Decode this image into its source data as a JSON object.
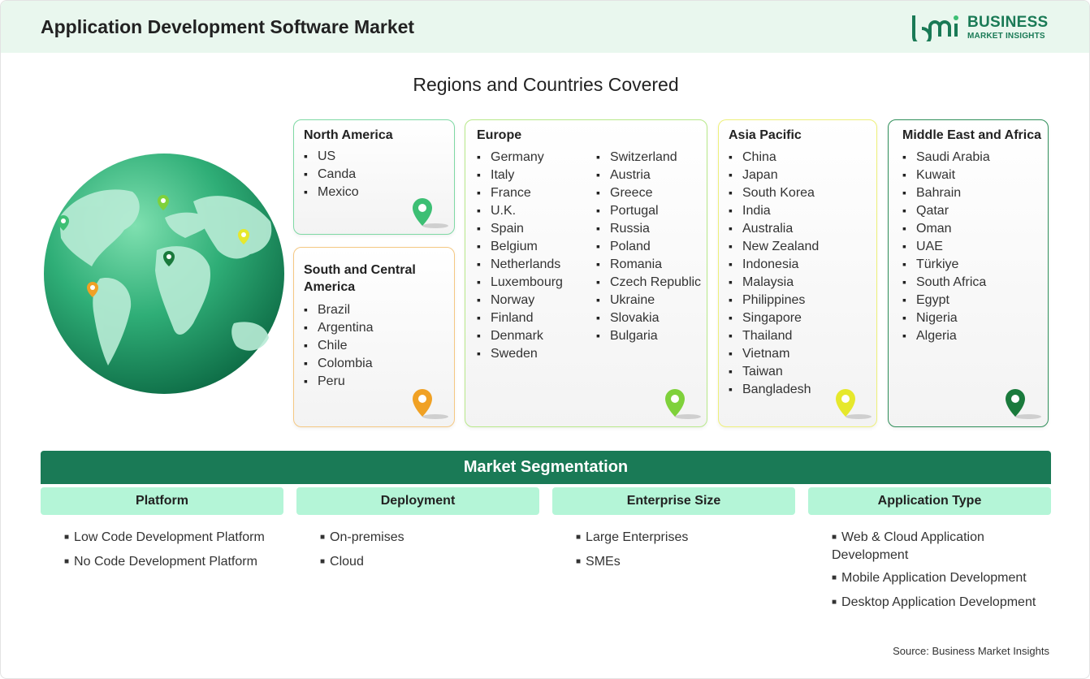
{
  "header": {
    "title": "Application Development Software Market",
    "logo": {
      "word1": "BUSINESS",
      "word2": "MARKET INSIGHTS",
      "mark": "bmi",
      "color": "#1a7a56"
    }
  },
  "regions_title": "Regions and Countries Covered",
  "regions": {
    "north_america": {
      "title": "North America",
      "items": [
        "US",
        "Canda",
        "Mexico"
      ],
      "color": "#3dbf74"
    },
    "south_central_america": {
      "title": "South and Central America",
      "items": [
        "Brazil",
        "Argentina",
        "Chile",
        "Colombia",
        "Peru"
      ],
      "color": "#f0a124"
    },
    "europe": {
      "title": "Europe",
      "col1": [
        "Germany",
        "Italy",
        "France",
        "U.K.",
        "Spain",
        "Belgium",
        "Netherlands",
        "Luxembourg",
        "Norway",
        "Finland",
        "Denmark",
        "Sweden"
      ],
      "col2": [
        "Switzerland",
        "Austria",
        "Greece",
        "Portugal",
        "Russia",
        "Poland",
        "Romania",
        "Czech Republic",
        "Ukraine",
        "Slovakia",
        "Bulgaria"
      ],
      "color": "#7fd13b"
    },
    "asia_pacific": {
      "title": "Asia Pacific",
      "items": [
        "China",
        "Japan",
        "South Korea",
        "India",
        "Australia",
        "New Zealand",
        "Indonesia",
        "Malaysia",
        "Philippines",
        "Singapore",
        "Thailand",
        "Vietnam",
        "Taiwan",
        "Bangladesh"
      ],
      "color": "#e6e82c"
    },
    "middle_east_africa": {
      "title": "Middle East and Africa",
      "items": [
        "Saudi Arabia",
        "Kuwait",
        "Bahrain",
        "Qatar",
        "Oman",
        "UAE",
        "Türkiye",
        "South Africa",
        "Egypt",
        "Nigeria",
        "Algeria"
      ],
      "color": "#1a7a3c"
    }
  },
  "segmentation": {
    "title": "Market Segmentation",
    "columns": [
      {
        "label": "Platform",
        "items": [
          "Low Code Development Platform",
          "No Code Development Platform"
        ]
      },
      {
        "label": "Deployment",
        "items": [
          "On-premises",
          "Cloud"
        ]
      },
      {
        "label": "Enterprise Size",
        "items": [
          "Large Enterprises",
          "SMEs"
        ]
      },
      {
        "label": "Application Type",
        "items": [
          "Web & Cloud Application Development",
          "Mobile Application Development",
          "Desktop Application Development"
        ]
      }
    ]
  },
  "source": "Source: Business Market Insights"
}
